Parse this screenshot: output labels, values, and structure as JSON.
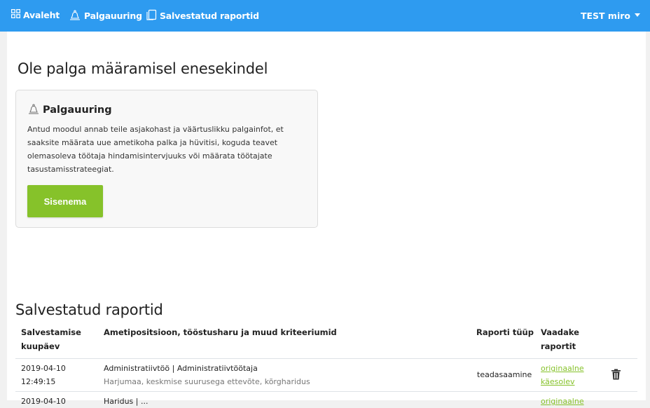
{
  "nav": {
    "items": [
      {
        "label": "Avaleht",
        "icon": "grid-icon"
      },
      {
        "label": "Palgauuring",
        "icon": "bell-icon"
      },
      {
        "label": "Salvestatud raportid",
        "icon": "copy-icon"
      }
    ],
    "user": "TEST miro"
  },
  "hero": {
    "title": "Ole palga määramisel enesekindel"
  },
  "card": {
    "title": "Palgauuring",
    "description": "Antud moodul annab teile asjakohast ja väärtuslikku palgainfot, et saaksite määrata uue ametikoha palka ja hüvitisi, koguda teavet olemasoleva töötaja hindamisintervjuuks või määrata töötajate tasustamisstrateegiat.",
    "button": "Sisenema"
  },
  "reports": {
    "title": "Salvestatud raportid",
    "columns": [
      "Salvestamise kuupäev",
      "Ametipositsioon, tööstusharu ja muud kriteeriumid",
      "Raporti tüüp",
      "Vaadake raportit"
    ],
    "rows": [
      {
        "date": "2019-04-10",
        "time": "12:49:15",
        "position": "Administratiivtöö | Administratiivtöötaja",
        "criteria": "Harjumaa, keskmise suurusega ettevõte, kõrgharidus",
        "type": "teadasaamine",
        "link_original": "originaalne",
        "link_current": "käesolev"
      },
      {
        "date": "2019-04-10",
        "position": "Haridus | ...",
        "type": "",
        "link_original": "originaalne"
      }
    ]
  },
  "colors": {
    "topbar": "#2e9bf0",
    "accent_green": "#86c22a",
    "background": "#f1f1f1"
  }
}
